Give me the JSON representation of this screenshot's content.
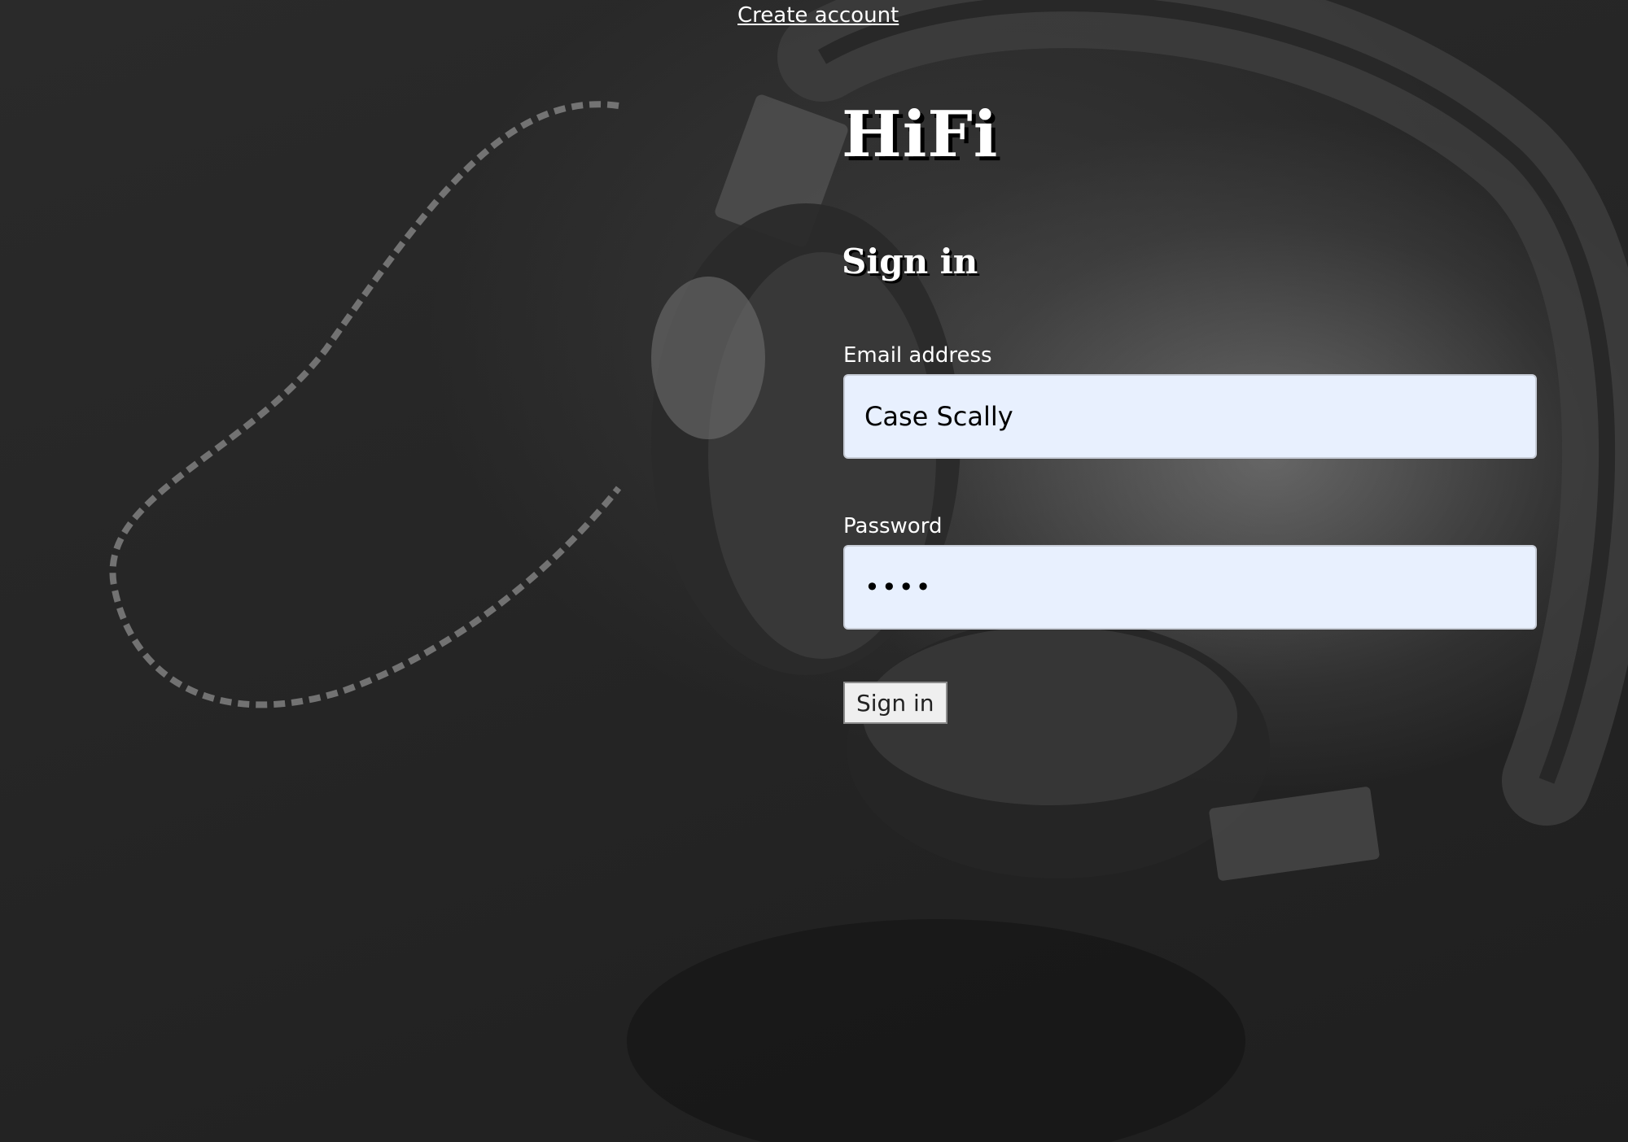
{
  "nav": {
    "create_account_label": "Create account"
  },
  "brand": {
    "title": "HiFi"
  },
  "form": {
    "heading": "Sign in",
    "email_label": "Email address",
    "email_value": "Case Scally",
    "password_label": "Password",
    "password_value": "abcd",
    "submit_label": "Sign in"
  },
  "colors": {
    "input_background": "#e8f0fe",
    "text": "#ffffff",
    "page_background": "#232323"
  },
  "background": {
    "image_subject": "headphones-photo"
  }
}
